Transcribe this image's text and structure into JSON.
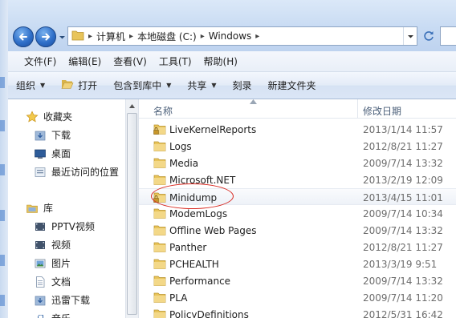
{
  "address": {
    "crumbs": [
      "计算机",
      "本地磁盘 (C:)",
      "Windows"
    ]
  },
  "menu": [
    "文件(F)",
    "编辑(E)",
    "查看(V)",
    "工具(T)",
    "帮助(H)"
  ],
  "toolbar": {
    "organize": "组织",
    "open": "打开",
    "include": "包含到库中",
    "share": "共享",
    "burn": "刻录",
    "new_folder": "新建文件夹"
  },
  "nav": {
    "favorites": "收藏夹",
    "fav_items": [
      "下载",
      "桌面",
      "最近访问的位置"
    ],
    "libraries": "库",
    "lib_items": [
      "PPTV视频",
      "视频",
      "图片",
      "文档",
      "迅雷下载",
      "音乐"
    ]
  },
  "columns": {
    "name": "名称",
    "date": "修改日期"
  },
  "files": [
    {
      "name": "LiveKernelReports",
      "date": "2013/1/14 11:57",
      "locked": true
    },
    {
      "name": "Logs",
      "date": "2012/8/21 11:27",
      "locked": false
    },
    {
      "name": "Media",
      "date": "2009/7/14 13:32",
      "locked": false
    },
    {
      "name": "Microsoft.NET",
      "date": "2013/2/19 12:09",
      "locked": false
    },
    {
      "name": "Minidump",
      "date": "2013/4/15 11:01",
      "locked": true
    },
    {
      "name": "ModemLogs",
      "date": "2009/7/14 10:34",
      "locked": false
    },
    {
      "name": "Offline Web Pages",
      "date": "2009/7/14 13:32",
      "locked": false
    },
    {
      "name": "Panther",
      "date": "2012/8/21 11:27",
      "locked": false
    },
    {
      "name": "PCHEALTH",
      "date": "2013/3/19 9:51",
      "locked": false
    },
    {
      "name": "Performance",
      "date": "2009/7/14 13:32",
      "locked": false
    },
    {
      "name": "PLA",
      "date": "2009/7/14 11:20",
      "locked": false
    },
    {
      "name": "PolicyDefinitions",
      "date": "2012/5/31 16:42",
      "locked": false
    }
  ],
  "colors": {
    "annotation": "#d8261e",
    "folder": "#e8c45a",
    "accent": "#2f6fc9"
  }
}
